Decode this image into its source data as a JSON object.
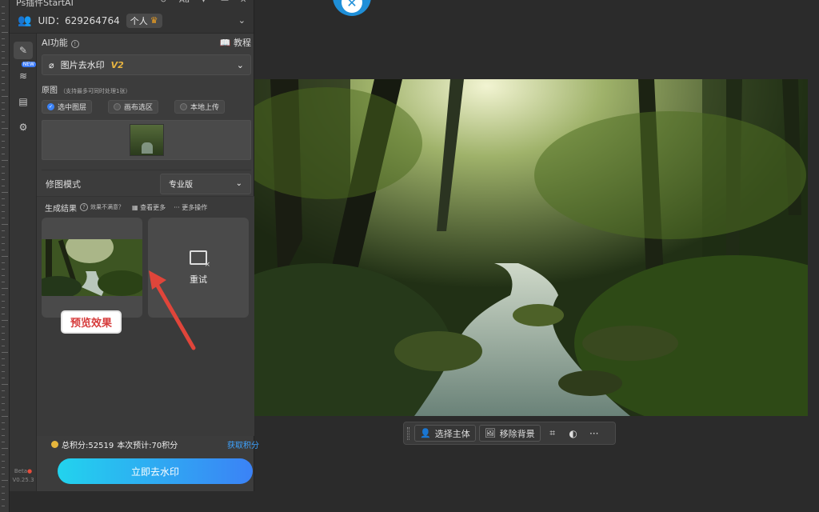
{
  "window": {
    "title": "Ps插件StartAI"
  },
  "account": {
    "uid": "UID：629264764",
    "plan": "个人"
  },
  "sidebar": {
    "beta": "Beta",
    "version": "V0.25.3",
    "new_tag": "NEW"
  },
  "ai": {
    "label": "AI功能",
    "tutorial": "教程",
    "function_value": "图片去水印",
    "function_version": "V2"
  },
  "source": {
    "label": "原图",
    "hint": "（支持最多可同时处理1张）",
    "options": [
      "选中图层",
      "画布选区",
      "本地上传"
    ]
  },
  "mode": {
    "label": "修图模式",
    "value": "专业版"
  },
  "result": {
    "label": "生成结果",
    "hint": "效果不满意？",
    "more": "查看更多",
    "more_actions": "··· 更多操作",
    "retry": "重试",
    "annotation": "预览效果"
  },
  "footer": {
    "points": "总积分:52519",
    "estimate": "本次预计:70积分",
    "get_points": "获取积分",
    "submit": "立即去水印"
  },
  "toolbar": {
    "select_subject": "选择主体",
    "remove_bg": "移除背景"
  },
  "colors": {
    "accent": "#3b82f6",
    "annotation_red": "#d63b3b",
    "gold": "#e8b440"
  }
}
